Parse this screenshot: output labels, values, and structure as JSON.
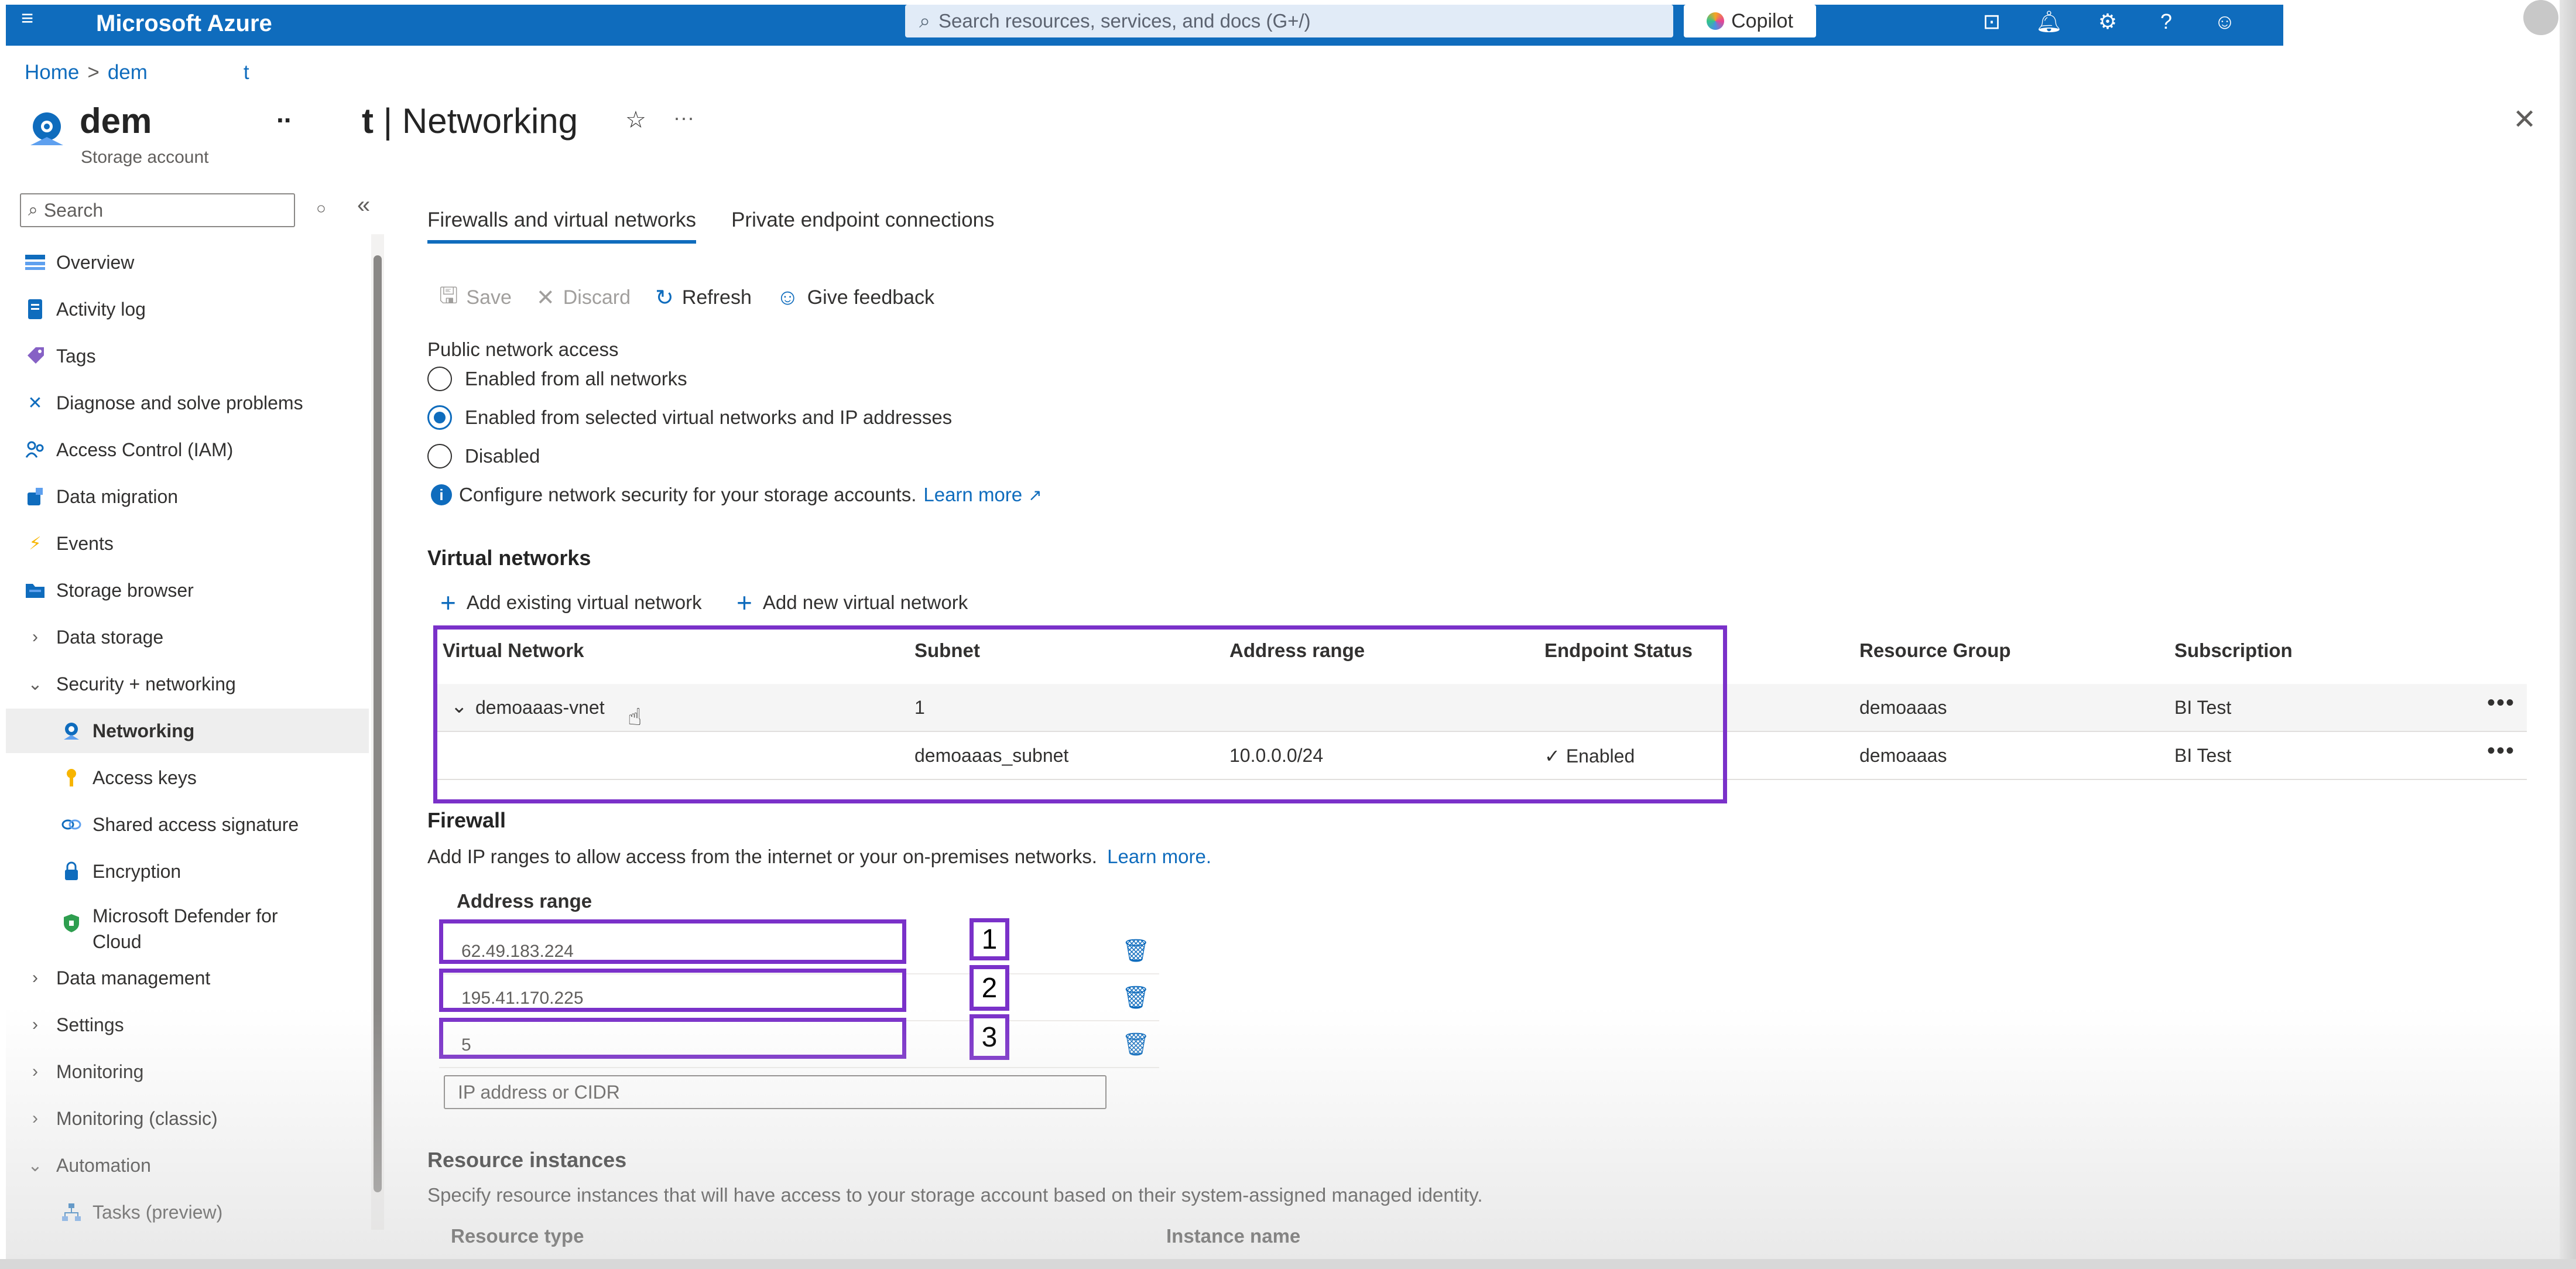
{
  "app": {
    "brand": "Microsoft Azure",
    "search_placeholder": "Search resources, services, and docs (G+/)",
    "copilot_label": "Copilot"
  },
  "breadcrumb": {
    "home": "Home",
    "sep": ">",
    "item": "dem",
    "tail": "t"
  },
  "resource": {
    "name": "dem",
    "name_dots": "..",
    "type": "Storage account",
    "page_title_prefix": "t",
    "page_title": "| Networking"
  },
  "left_nav": {
    "search_placeholder": "Search",
    "items": [
      {
        "label": "Overview",
        "icon": "overview-icon"
      },
      {
        "label": "Activity log",
        "icon": "activity-log-icon"
      },
      {
        "label": "Tags",
        "icon": "tag-icon"
      },
      {
        "label": "Diagnose and solve problems",
        "icon": "wrench-icon"
      },
      {
        "label": "Access Control (IAM)",
        "icon": "people-icon"
      },
      {
        "label": "Data migration",
        "icon": "migration-icon"
      },
      {
        "label": "Events",
        "icon": "lightning-icon"
      },
      {
        "label": "Storage browser",
        "icon": "folder-icon"
      },
      {
        "label": "Data storage",
        "icon": "chevron-right-icon"
      },
      {
        "label": "Security + networking",
        "icon": "chevron-down-icon"
      },
      {
        "label": "Networking",
        "icon": "networking-icon"
      },
      {
        "label": "Access keys",
        "icon": "key-icon"
      },
      {
        "label": "Shared access signature",
        "icon": "link-icon"
      },
      {
        "label": "Encryption",
        "icon": "lock-icon"
      },
      {
        "label": "Microsoft Defender for",
        "label2": "Cloud",
        "icon": "shield-icon"
      },
      {
        "label": "Data management",
        "icon": "chevron-right-icon"
      },
      {
        "label": "Settings",
        "icon": "chevron-right-icon"
      },
      {
        "label": "Monitoring",
        "icon": "chevron-right-icon"
      },
      {
        "label": "Monitoring (classic)",
        "icon": "chevron-right-icon"
      },
      {
        "label": "Automation",
        "icon": "chevron-down-icon"
      },
      {
        "label": "Tasks (preview)",
        "icon": "tasks-icon"
      }
    ]
  },
  "tabs": [
    {
      "label": "Firewalls and virtual networks",
      "active": true
    },
    {
      "label": "Private endpoint connections",
      "active": false
    }
  ],
  "toolbar": {
    "save": "Save",
    "discard": "Discard",
    "refresh": "Refresh",
    "feedback": "Give feedback"
  },
  "public_access": {
    "label": "Public network access",
    "options": [
      {
        "label": "Enabled from all networks",
        "selected": false
      },
      {
        "label": "Enabled from selected virtual networks and IP addresses",
        "selected": true
      },
      {
        "label": "Disabled",
        "selected": false
      }
    ],
    "info_text": "Configure network security for your storage accounts.",
    "learn_more": "Learn more"
  },
  "virtual_networks": {
    "heading": "Virtual networks",
    "add_existing": "Add existing virtual network",
    "add_new": "Add new virtual network",
    "columns": [
      "Virtual Network",
      "Subnet",
      "Address range",
      "Endpoint Status",
      "Resource Group",
      "Subscription"
    ],
    "group_row": {
      "vnet": "demoaaas-vnet",
      "subnet": "1",
      "address": "",
      "status": "",
      "rg": "demoaaas",
      "sub": "BI Test"
    },
    "sub_row": {
      "vnet": "",
      "subnet": "demoaaas_subnet",
      "address": "10.0.0.0/24",
      "status": "Enabled",
      "rg": "demoaaas",
      "sub": "BI Test"
    }
  },
  "firewall": {
    "heading": "Firewall",
    "description": "Add IP ranges to allow access from the internet or your on-premises networks.",
    "learn_more": "Learn more.",
    "column": "Address range",
    "rows": [
      "62.49.183.224",
      "195.41.170.225",
      "5"
    ],
    "labels": [
      "1",
      "2",
      "3"
    ],
    "input_placeholder": "IP address or CIDR"
  },
  "resource_instances": {
    "heading": "Resource instances",
    "description": "Specify resource instances that will have access to your storage account based on their system-assigned managed identity.",
    "col_type": "Resource type",
    "col_name": "Instance name"
  },
  "colors": {
    "accent": "#0f6cbd",
    "highlight": "#7a31c9"
  }
}
